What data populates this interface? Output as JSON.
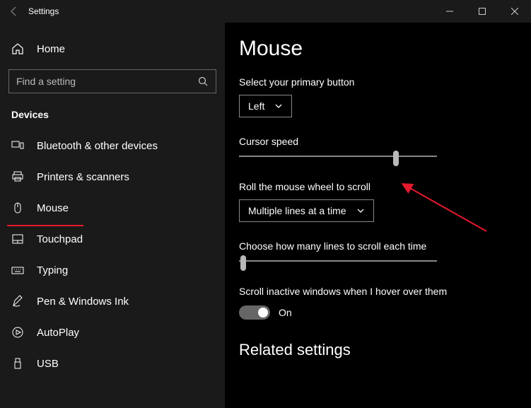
{
  "titlebar": {
    "app_name": "Settings"
  },
  "sidebar": {
    "home_label": "Home",
    "search_placeholder": "Find a setting",
    "category": "Devices",
    "items": [
      {
        "label": "Bluetooth & other devices"
      },
      {
        "label": "Printers & scanners"
      },
      {
        "label": "Mouse"
      },
      {
        "label": "Touchpad"
      },
      {
        "label": "Typing"
      },
      {
        "label": "Pen & Windows Ink"
      },
      {
        "label": "AutoPlay"
      },
      {
        "label": "USB"
      }
    ]
  },
  "main": {
    "title": "Mouse",
    "primary_button": {
      "label": "Select your primary button",
      "value": "Left"
    },
    "cursor_speed": {
      "label": "Cursor speed",
      "value": 78
    },
    "wheel_scroll": {
      "label": "Roll the mouse wheel to scroll",
      "value": "Multiple lines at a time"
    },
    "lines_scroll": {
      "label": "Choose how many lines to scroll each time",
      "value": 1
    },
    "inactive_scroll": {
      "label": "Scroll inactive windows when I hover over them",
      "state": "On"
    },
    "related_heading": "Related settings"
  }
}
